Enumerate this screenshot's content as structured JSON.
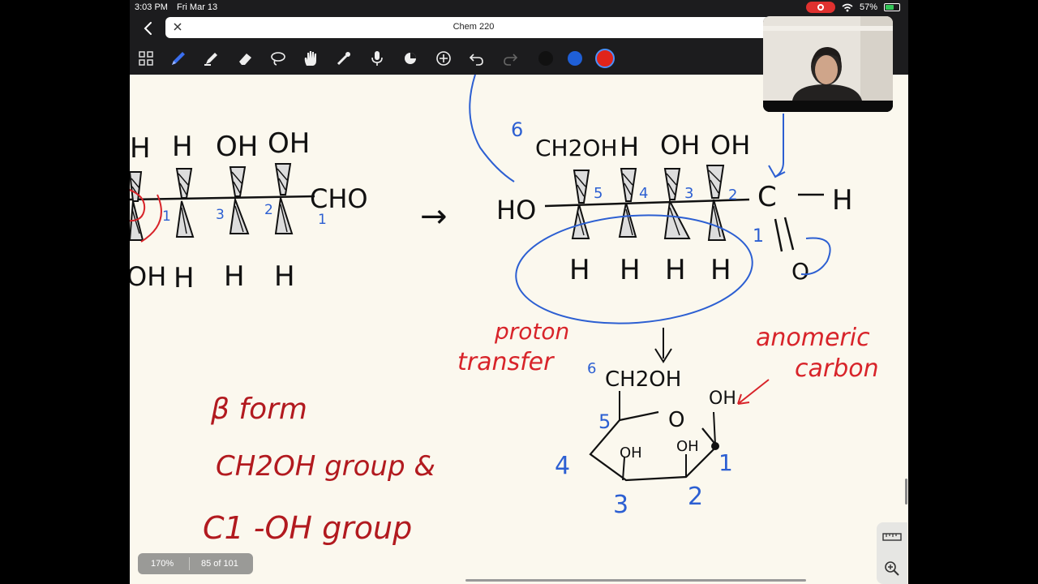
{
  "status_bar": {
    "time": "3:03 PM",
    "date": "Fri Mar 13",
    "battery": "57%",
    "battery_level": 0.57
  },
  "document": {
    "title": "Chem 220"
  },
  "toolbar": {
    "tools": [
      "pages-icon",
      "pen-icon",
      "highlighter-icon",
      "eraser-icon",
      "lasso-icon",
      "hand-icon",
      "laser-pointer-icon",
      "microphone-icon",
      "shape-icon",
      "add-icon",
      "undo-icon",
      "redo-icon"
    ],
    "colors": [
      "#111111",
      "#1f5fd6",
      "#e0241b"
    ],
    "selected_color": "#e0241b"
  },
  "footer": {
    "zoom": "170%",
    "page": "85 of 101"
  },
  "notes": {
    "left_chain": {
      "top": [
        "H",
        "H",
        "OH",
        "OH"
      ],
      "bottom": [
        "OH",
        "H",
        "H",
        "H"
      ],
      "end": "CHO",
      "numbers": [
        "1",
        "3",
        "2",
        "1"
      ]
    },
    "arrow": "→",
    "right_chain": {
      "top": [
        "CH2OH",
        "H",
        "OH",
        "OH"
      ],
      "bottom": [
        "H",
        "H",
        "H",
        "H"
      ],
      "left_group": "HO",
      "carbonyl": [
        "C",
        "H",
        "O"
      ],
      "numbers": [
        "6",
        "5",
        "4",
        "3",
        "2",
        "1"
      ]
    },
    "proton_transfer": [
      "proton",
      "transfer"
    ],
    "anomeric": [
      "anomeric",
      "carbon"
    ],
    "ring": {
      "ch2oh": "CH2OH",
      "oh1": "OH",
      "oh2": "OH",
      "oh3": "OH",
      "o": "O",
      "numbers": [
        "6",
        "5",
        "4",
        "3",
        "2",
        "1"
      ]
    },
    "beta_form": [
      "β form",
      "CH2OH group &",
      "C1 -OH group"
    ]
  }
}
